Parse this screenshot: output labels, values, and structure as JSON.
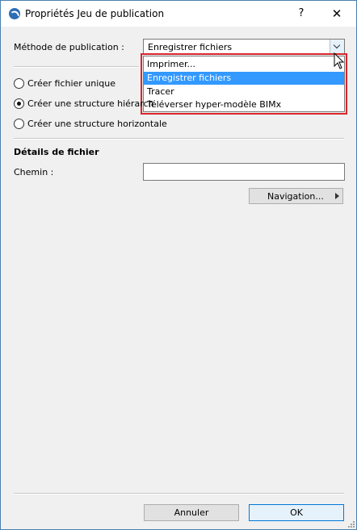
{
  "window": {
    "title": "Propriétés Jeu de publication",
    "help_label": "?",
    "close_label": "✕",
    "app_icon": "archicad-icon"
  },
  "publication": {
    "label": "Méthode de publication :",
    "selected": "Enregistrer fichiers",
    "options": [
      {
        "label": "Imprimer...",
        "selected": false
      },
      {
        "label": "Enregistrer fichiers",
        "selected": true
      },
      {
        "label": "Tracer",
        "selected": false
      },
      {
        "label": "Téléverser hyper-modèle BIMx",
        "selected": false
      }
    ]
  },
  "structure": {
    "options": [
      {
        "label": "Créer fichier unique",
        "checked": false
      },
      {
        "label": "Créer une structure hiérarch",
        "checked": true
      },
      {
        "label": "Créer une structure horizontale",
        "checked": false
      }
    ]
  },
  "details": {
    "title": "Détails de fichier",
    "path_label": "Chemin :",
    "path_value": "",
    "navigation_label": "Navigation..."
  },
  "footer": {
    "cancel_label": "Annuler",
    "ok_label": "OK"
  },
  "colors": {
    "selection": "#3399ff",
    "highlight_border": "#d9262c"
  }
}
